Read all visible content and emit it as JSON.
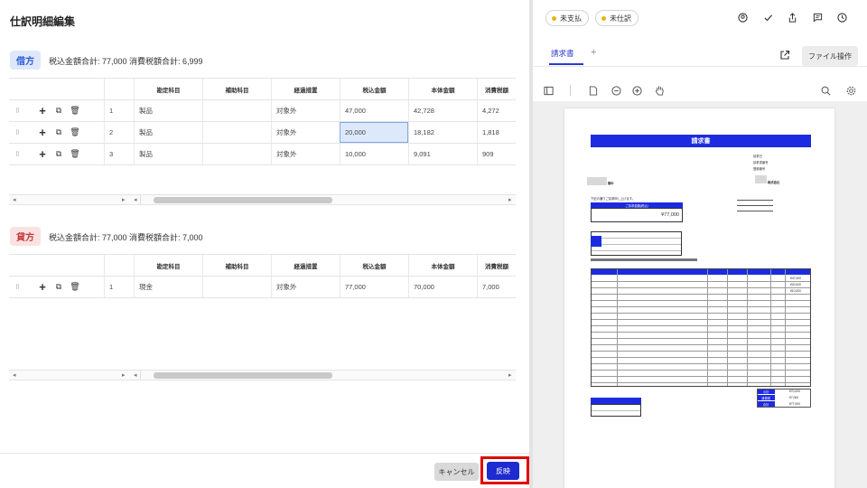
{
  "left": {
    "title": "仕訳明細編集",
    "debit": {
      "badge": "借方",
      "summary": "税込金額合計: 77,000 消費税額合計: 6,999",
      "columns": [
        "勘定科目",
        "補助科目",
        "経過措置",
        "税込金額",
        "本体金額",
        "消費税額"
      ],
      "rows": [
        {
          "no": "1",
          "account": "製品",
          "sub": "",
          "transition": "対象外",
          "incl": "47,000",
          "base": "42,728",
          "tax": "4,272"
        },
        {
          "no": "2",
          "account": "製品",
          "sub": "",
          "transition": "対象外",
          "incl": "20,000",
          "base": "18,182",
          "tax": "1,818"
        },
        {
          "no": "3",
          "account": "製品",
          "sub": "",
          "transition": "対象外",
          "incl": "10,000",
          "base": "9,091",
          "tax": "909"
        }
      ]
    },
    "credit": {
      "badge": "貸方",
      "summary": "税込金額合計: 77,000 消費税額合計: 7,000",
      "columns": [
        "勘定科目",
        "補助科目",
        "経過措置",
        "税込金額",
        "本体金額",
        "消費税額"
      ],
      "rows": [
        {
          "no": "1",
          "account": "現金",
          "sub": "",
          "transition": "対象外",
          "incl": "77,000",
          "base": "70,000",
          "tax": "7,000"
        }
      ]
    },
    "buttons": {
      "cancel": "キャンセル",
      "apply": "反映"
    }
  },
  "right": {
    "chips": [
      "未支払",
      "未仕訳"
    ],
    "tab": "請求書",
    "tab_add": "+",
    "file_button": "ファイル操作",
    "icons": {
      "top": [
        "user-circle-icon",
        "check-icon",
        "share-icon",
        "comment-icon",
        "clock-icon"
      ],
      "viewer": [
        "sidebar-toggle-icon",
        "document-icon",
        "zoom-out-icon",
        "zoom-in-icon",
        "hand-icon",
        "search-icon",
        "settings-icon"
      ]
    },
    "doc": {
      "title": "請求書",
      "meta": [
        "請求日",
        "請求書番号",
        "登録番号"
      ],
      "recipient_suffix": "御中",
      "company_suffix": "株式会社",
      "greeting": "下記の通りご請求申し上げます。",
      "amount_label": "ご請求金額(税込)",
      "amount": "¥77,000",
      "item_rows": [
        "¥47,000",
        "¥20,000",
        "¥10,000"
      ],
      "totals": [
        {
          "label": "小計",
          "value": "¥70,000"
        },
        {
          "label": "消費税",
          "value": "¥7,000"
        },
        {
          "label": "合計",
          "value": "¥77,000"
        }
      ]
    }
  },
  "colors": {
    "accent": "#1d2bd0",
    "highlight": "#e00000",
    "pending": "#e8b21a"
  }
}
